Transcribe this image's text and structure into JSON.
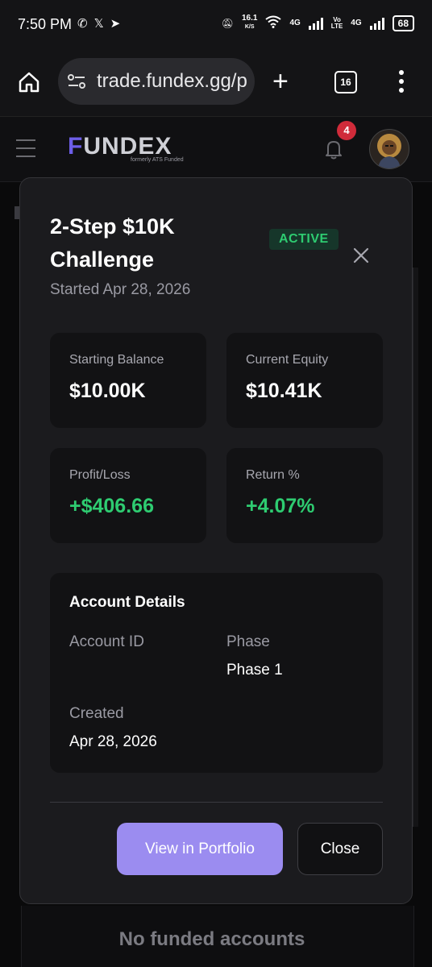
{
  "status_bar": {
    "time": "7:50 PM",
    "net_speed": "16.1",
    "net_speed_unit": "K/S",
    "network_4g_1": "4G",
    "volte_top": "Vo",
    "volte_bottom": "LTE",
    "network_4g_2": "4G",
    "battery": "68",
    "icons": [
      "whatsapp-icon",
      "x-icon",
      "telegram-icon",
      "mute-icon",
      "wifi-icon",
      "signal-icon"
    ]
  },
  "browser": {
    "url": "trade.fundex.gg/p",
    "tab_count": "16"
  },
  "app_header": {
    "logo_text_accent": "F",
    "logo_text": "UNDEX",
    "logo_subtitle": "formerly ATS Funded",
    "notification_count": "4"
  },
  "modal": {
    "title": "2-Step $10K Challenge",
    "status": "ACTIVE",
    "started": "Started Apr 28, 2026",
    "stats": [
      {
        "label": "Starting Balance",
        "value": "$10.00K"
      },
      {
        "label": "Current Equity",
        "value": "$10.41K"
      },
      {
        "label": "Profit/Loss",
        "value": "+$406.66"
      },
      {
        "label": "Return %",
        "value": "+4.07%"
      }
    ],
    "details": {
      "title": "Account Details",
      "account_id_label": "Account ID",
      "account_id_value": "",
      "phase_label": "Phase",
      "phase_value": "Phase 1",
      "created_label": "Created",
      "created_value": "Apr 28, 2026"
    },
    "primary_button": "View in Portfolio",
    "secondary_button": "Close"
  },
  "background": {
    "empty_text": "No funded accounts"
  },
  "colors": {
    "accent_purple": "#9b8cf0",
    "positive_green": "#2ecc71",
    "badge_red": "#d02b3a",
    "modal_bg": "#1b1b1e"
  }
}
